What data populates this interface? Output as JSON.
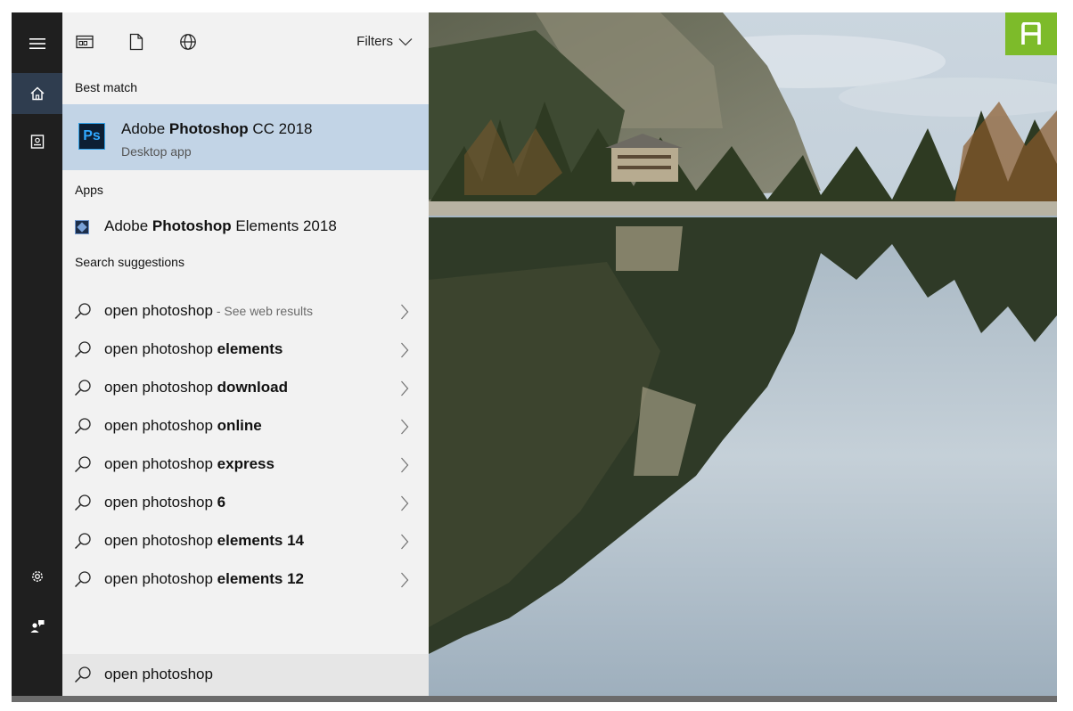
{
  "corner_badge": {
    "letter": "A",
    "color": "#7dbb2a"
  },
  "rail": {
    "items": [
      {
        "icon": "hamburger-menu-icon"
      },
      {
        "icon": "home-icon",
        "active": true
      },
      {
        "icon": "documents-icon"
      },
      {
        "icon": "gear-icon"
      },
      {
        "icon": "feedback-icon"
      }
    ]
  },
  "topbar": {
    "scopes": [
      {
        "icon": "apps-scope-icon"
      },
      {
        "icon": "documents-scope-icon"
      },
      {
        "icon": "web-scope-icon"
      }
    ],
    "filters_label": "Filters"
  },
  "best_match": {
    "heading": "Best match",
    "icon_text": "Ps",
    "title_pre": "Adobe ",
    "title_bold": "Photoshop",
    "title_post": " CC 2018",
    "subtitle": "Desktop app"
  },
  "apps": {
    "heading": "Apps",
    "items": [
      {
        "pre": "Adobe ",
        "bold": "Photoshop",
        "post": " Elements 2018"
      }
    ]
  },
  "suggestions": {
    "heading": "Search suggestions",
    "items": [
      {
        "base": "open photoshop",
        "bold": "",
        "hint": " - See web results"
      },
      {
        "base": "open photoshop ",
        "bold": "elements",
        "hint": ""
      },
      {
        "base": "open photoshop ",
        "bold": "download",
        "hint": ""
      },
      {
        "base": "open photoshop ",
        "bold": "online",
        "hint": ""
      },
      {
        "base": "open photoshop ",
        "bold": "express",
        "hint": ""
      },
      {
        "base": "open photoshop ",
        "bold": "6",
        "hint": ""
      },
      {
        "base": "open photoshop ",
        "bold": "elements 14",
        "hint": ""
      },
      {
        "base": "open photoshop ",
        "bold": "elements 12",
        "hint": ""
      }
    ]
  },
  "search_box": {
    "value": "open photoshop"
  },
  "colors": {
    "rail_bg": "#1f1f1f",
    "rail_active": "#2f3d4f",
    "panel_bg": "#f2f2f2",
    "best_match_bg": "#c2d4e6",
    "search_bg": "#e6e6e6"
  }
}
